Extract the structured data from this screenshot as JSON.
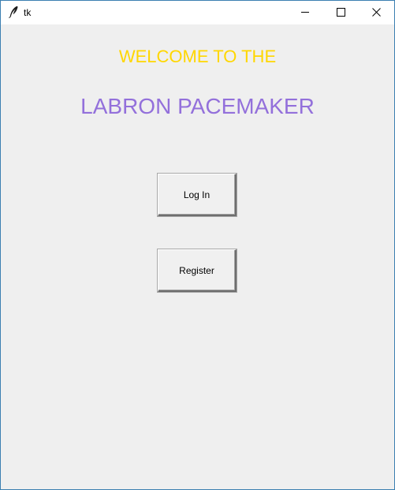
{
  "window": {
    "title": "tk",
    "icons": {
      "app": "feather-icon",
      "minimize": "minimize-icon",
      "maximize": "maximize-icon",
      "close": "close-icon"
    }
  },
  "main": {
    "welcome_text": "WELCOME TO THE",
    "app_name": "LABRON PACEMAKER",
    "buttons": {
      "login_label": "Log In",
      "register_label": "Register"
    }
  },
  "colors": {
    "welcome": "#ffd700",
    "app_name": "#9370db",
    "background": "#efefef"
  }
}
